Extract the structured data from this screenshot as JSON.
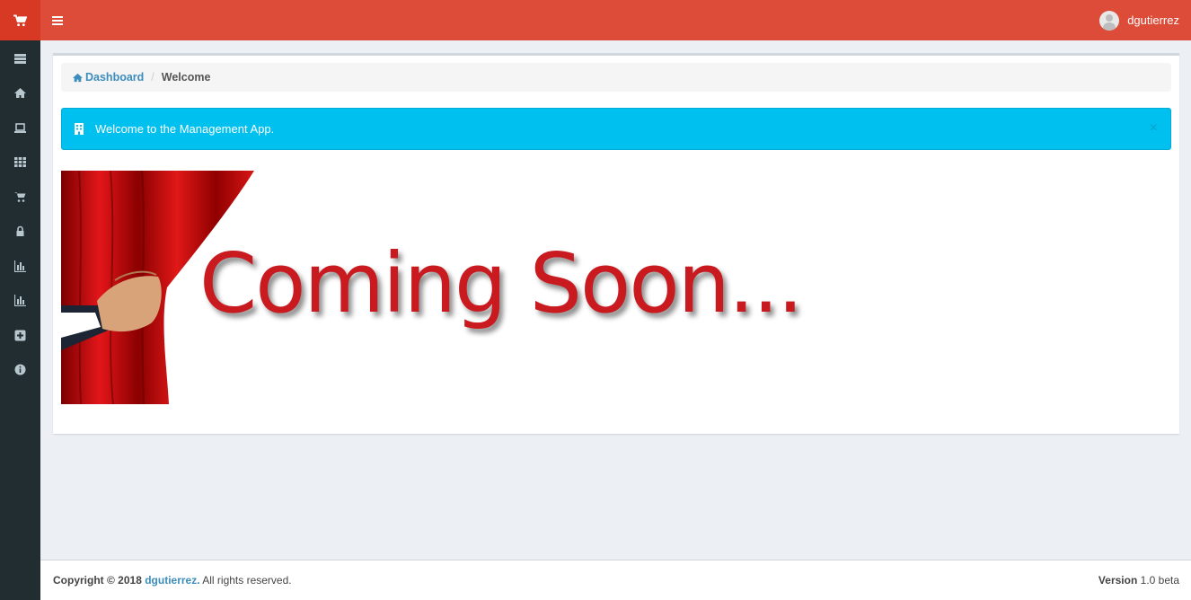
{
  "header": {
    "username": "dgutierrez"
  },
  "sidebar": {
    "items": [
      {
        "icon": "list-icon"
      },
      {
        "icon": "home-icon"
      },
      {
        "icon": "laptop-icon"
      },
      {
        "icon": "grid-icon"
      },
      {
        "icon": "cart-icon"
      },
      {
        "icon": "lock-icon"
      },
      {
        "icon": "bar-chart-icon"
      },
      {
        "icon": "bar-chart-icon"
      },
      {
        "icon": "plus-square-icon"
      },
      {
        "icon": "info-icon"
      }
    ]
  },
  "breadcrumb": {
    "home_label": "Dashboard",
    "separator": "/",
    "current": "Welcome"
  },
  "alert": {
    "message": "Welcome to the Management App.",
    "close": "×"
  },
  "banner": {
    "text": "Coming Soon..."
  },
  "footer": {
    "copyright_prefix": "Copyright © 2018",
    "copyright_link": "dgutierrez.",
    "copyright_suffix": "All rights reserved.",
    "version_label": "Version",
    "version_value": "1.0 beta"
  },
  "colors": {
    "topbar": "#dd4b39",
    "logo": "#d73925",
    "sidebar": "#222d32",
    "alert": "#00c0ef",
    "link": "#3c8dbc"
  }
}
